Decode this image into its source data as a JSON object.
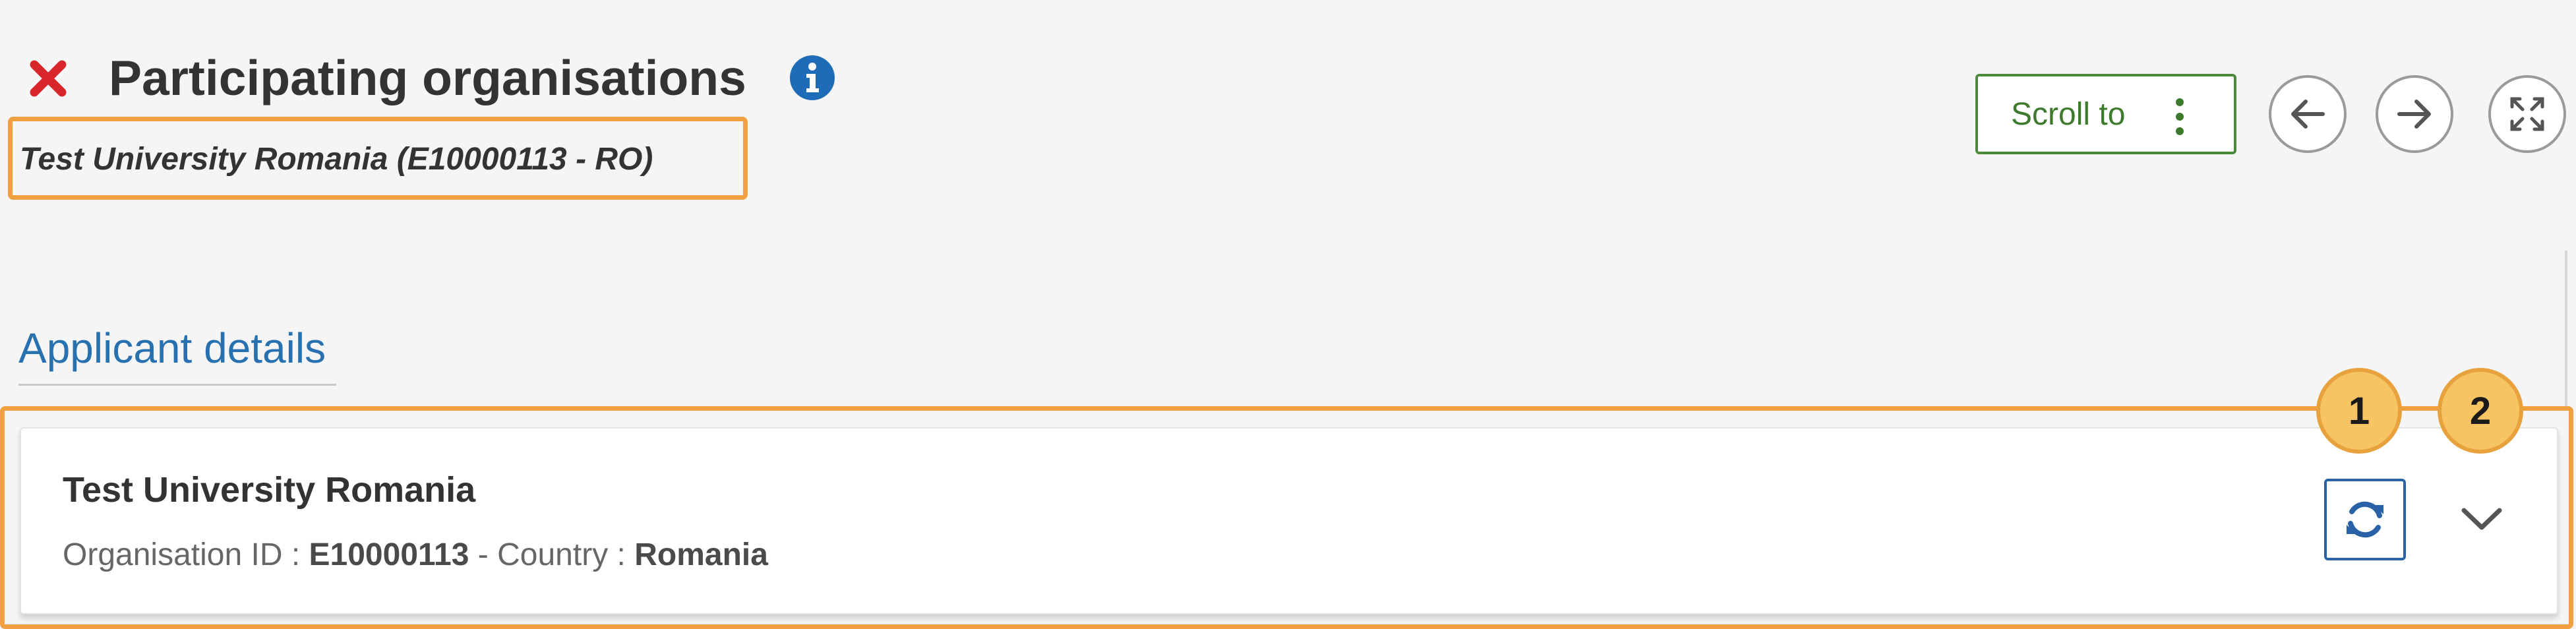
{
  "header": {
    "title": "Participating organisations",
    "organisation_line": "Test University Romania (E10000113 - RO)"
  },
  "toolbar": {
    "scroll_to_label": "Scroll to"
  },
  "section": {
    "heading": "Applicant details"
  },
  "card": {
    "organisation_name": "Test University Romania",
    "organisation_id_label": "Organisation ID :",
    "organisation_id": "E10000113",
    "separator": "-",
    "country_label": "Country :",
    "country": "Romania"
  },
  "callouts": [
    "1",
    "2"
  ],
  "icons": {
    "status": "close-x-icon",
    "info": "info-icon",
    "scroll_menu": "kebab-menu-icon",
    "previous": "arrow-left-icon",
    "next": "arrow-right-icon",
    "fullscreen": "expand-icon",
    "refresh": "refresh-icon",
    "expand_card": "chevron-down-icon"
  },
  "colors": {
    "error_red": "#d9262b",
    "info_blue": "#1e6bb8",
    "link_blue": "#2871b0",
    "button_green": "#3d7a2c",
    "highlight_orange": "#f0a040",
    "callout_fill": "#f7c463"
  }
}
